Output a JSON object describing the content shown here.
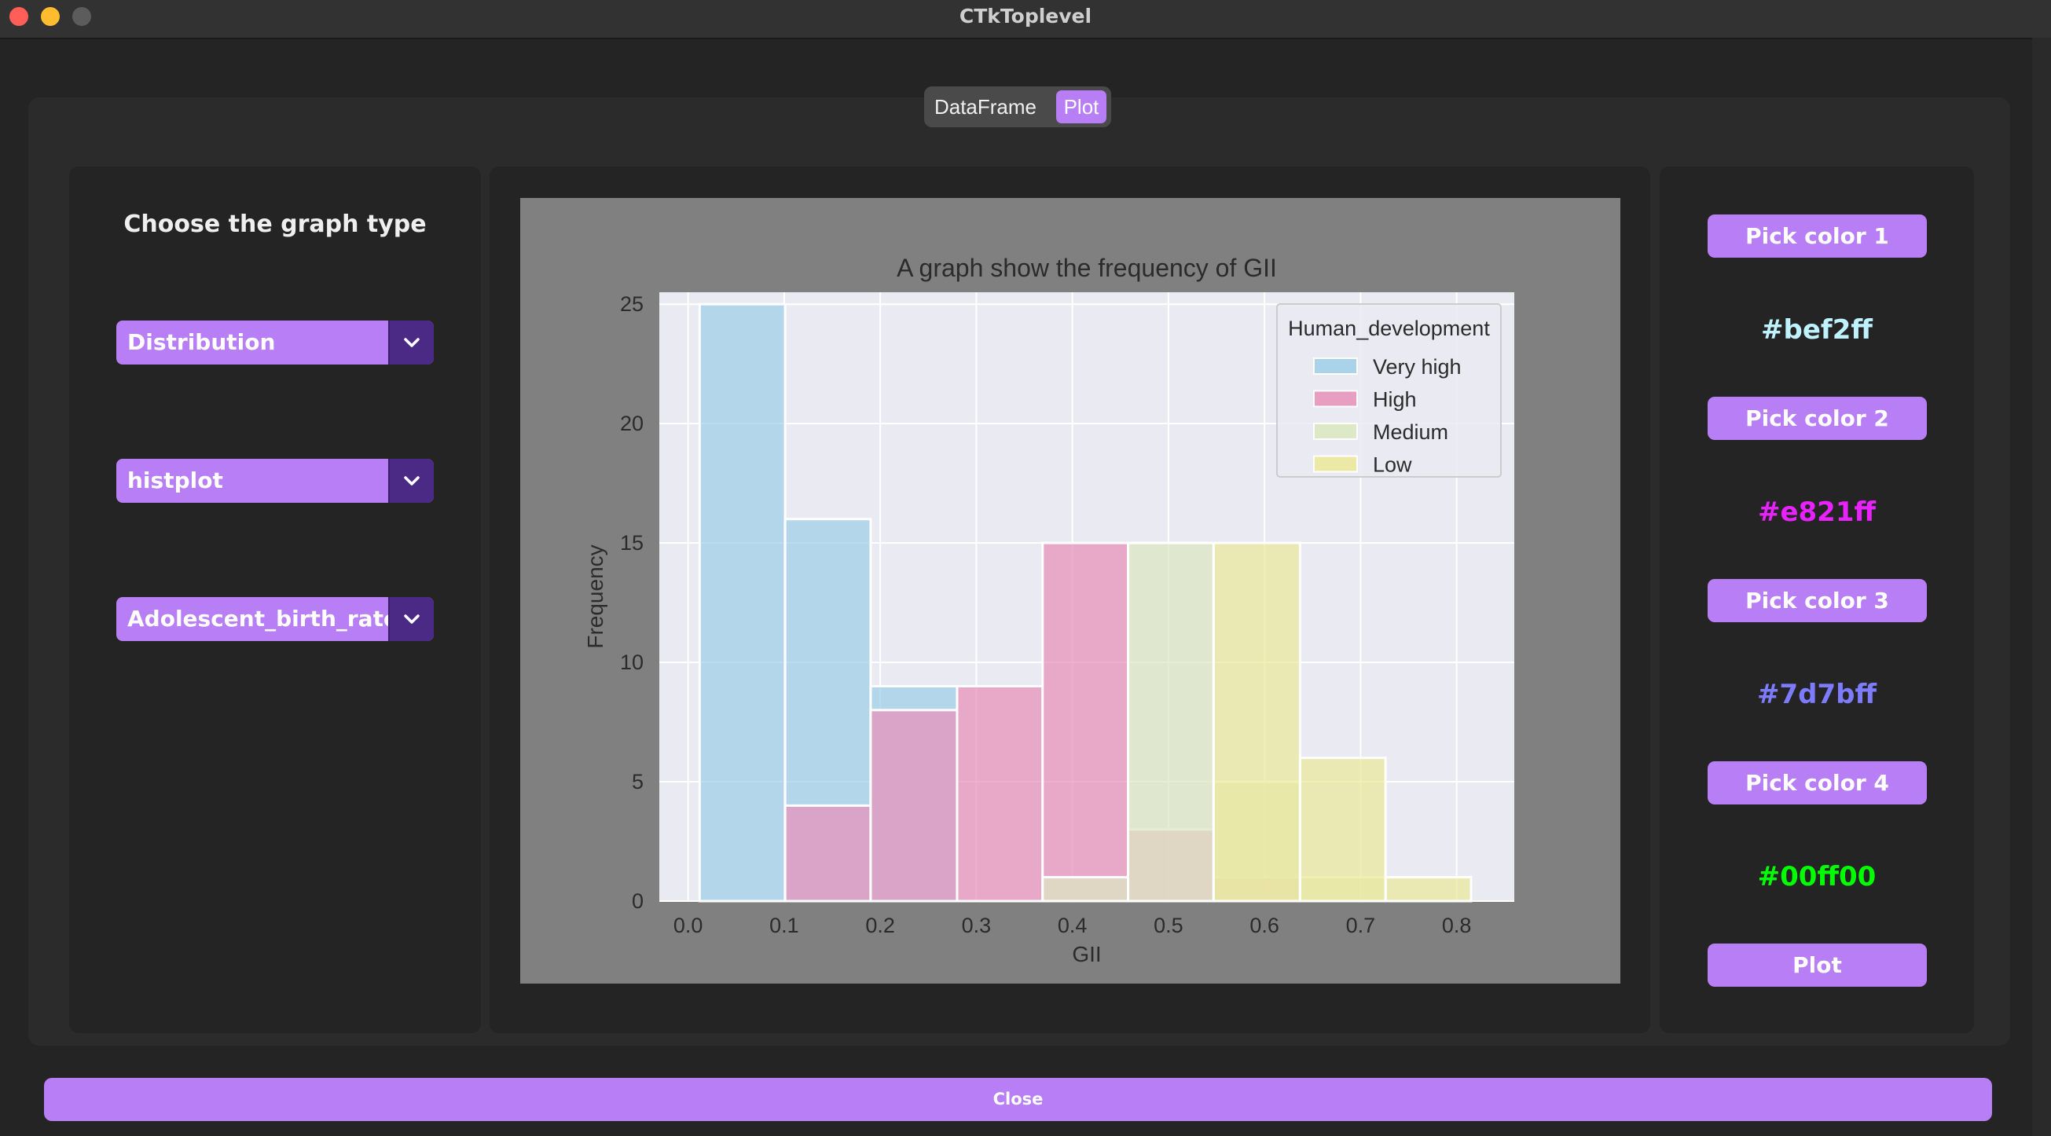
{
  "window": {
    "title": "CTkToplevel"
  },
  "tabs": {
    "dataframe_label": "DataFrame",
    "plot_label": "Plot",
    "active": "Plot"
  },
  "left_panel": {
    "heading": "Choose the graph type",
    "dropdowns": [
      {
        "value": "Distribution"
      },
      {
        "value": "histplot"
      },
      {
        "value": "Adolescent_birth_rate"
      }
    ]
  },
  "right_panel": {
    "pick_color_1": "Pick color 1",
    "color_1": "#bef2ff",
    "pick_color_2": "Pick color 2",
    "color_2": "#e821ff",
    "pick_color_3": "Pick color 3",
    "color_3": "#7d7bff",
    "pick_color_4": "Pick color 4",
    "color_4": "#00ff00",
    "plot_button": "Plot"
  },
  "footer": {
    "close_label": "Close"
  },
  "theme": {
    "accent": "#b77ef5",
    "accent_dark": "#4b2a86",
    "background": "#242424"
  },
  "chart_data": {
    "type": "bar",
    "title": "A graph show the frequency of GII",
    "xlabel": "GII",
    "ylabel": "Frequency",
    "xlim": [
      -0.03,
      0.86
    ],
    "ylim": [
      0,
      25.5
    ],
    "xticks": [
      0.0,
      0.1,
      0.2,
      0.3,
      0.4,
      0.5,
      0.6,
      0.7,
      0.8
    ],
    "xtick_labels": [
      "0.0",
      "0.1",
      "0.2",
      "0.3",
      "0.4",
      "0.5",
      "0.6",
      "0.7",
      "0.8"
    ],
    "yticks": [
      0,
      5,
      10,
      15,
      20,
      25
    ],
    "ytick_labels": [
      "0",
      "5",
      "10",
      "15",
      "20",
      "25"
    ],
    "grid": true,
    "legend": {
      "title": "Human_development",
      "position": "top-right"
    },
    "bin_edges": [
      0.012,
      0.101,
      0.19,
      0.28,
      0.369,
      0.458,
      0.547,
      0.637,
      0.726,
      0.815
    ],
    "series": [
      {
        "name": "Very high",
        "color": "#9fcfe8",
        "values": [
          25,
          16,
          9,
          0,
          0,
          0,
          0,
          0,
          0
        ]
      },
      {
        "name": "High",
        "color": "#e890b8",
        "values": [
          0,
          4,
          8,
          9,
          15,
          3,
          1,
          0,
          0
        ]
      },
      {
        "name": "Medium",
        "color": "#dbe8c0",
        "values": [
          0,
          0,
          0,
          0,
          1,
          15,
          5,
          1,
          0
        ]
      },
      {
        "name": "Low",
        "color": "#ece99a",
        "values": [
          0,
          0,
          0,
          0,
          0,
          0,
          15,
          6,
          1
        ]
      }
    ]
  }
}
